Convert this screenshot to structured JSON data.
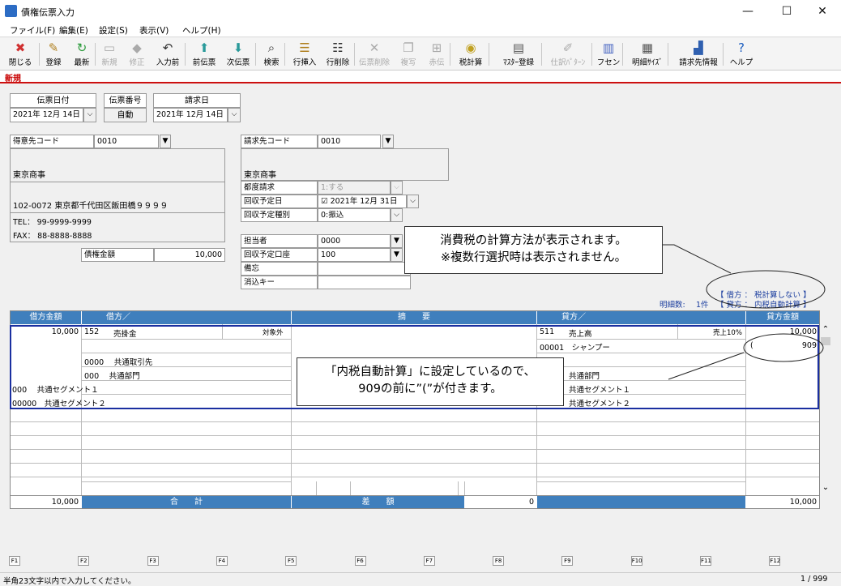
{
  "window": {
    "title": "債権伝票入力",
    "minimize": "—",
    "maximize": "☐",
    "close": "✕"
  },
  "menu": [
    "ファイル(F)",
    "編集(E)",
    "設定(S)",
    "表示(V)",
    "ヘルプ(H)"
  ],
  "toolbar": [
    {
      "label": "閉じる",
      "icon": "close-doc-icon",
      "glyph": "✖",
      "color": "#d03030",
      "enabled": true
    },
    {
      "label": "登録",
      "icon": "register-icon",
      "glyph": "✎",
      "color": "#b08020",
      "enabled": true
    },
    {
      "label": "最新",
      "icon": "refresh-icon",
      "glyph": "↻",
      "color": "#2a9a3a",
      "enabled": true
    },
    {
      "label": "新規",
      "icon": "new-doc-icon",
      "glyph": "▭",
      "color": "#aaaaaa",
      "enabled": false
    },
    {
      "label": "修正",
      "icon": "edit-icon",
      "glyph": "◆",
      "color": "#aaaaaa",
      "enabled": false
    },
    {
      "label": "入力前",
      "icon": "undo-input-icon",
      "glyph": "↶",
      "color": "#333333",
      "enabled": true
    },
    {
      "label": "前伝票",
      "icon": "prev-slip-icon",
      "glyph": "⬆",
      "color": "#2a9a9a",
      "enabled": true
    },
    {
      "label": "次伝票",
      "icon": "next-slip-icon",
      "glyph": "⬇",
      "color": "#2a9a9a",
      "enabled": true
    },
    {
      "label": "検索",
      "icon": "search-icon",
      "glyph": "⌕",
      "color": "#333333",
      "enabled": true
    },
    {
      "label": "行挿入",
      "icon": "insert-row-icon",
      "glyph": "☰",
      "color": "#b08020",
      "enabled": true
    },
    {
      "label": "行削除",
      "icon": "delete-row-icon",
      "glyph": "☷",
      "color": "#333333",
      "enabled": true
    },
    {
      "label": "伝票削除",
      "icon": "delete-slip-icon",
      "glyph": "✕",
      "color": "#aaaaaa",
      "enabled": false
    },
    {
      "label": "複写",
      "icon": "copy-icon",
      "glyph": "❐",
      "color": "#aaaaaa",
      "enabled": false
    },
    {
      "label": "赤伝",
      "icon": "red-slip-icon",
      "glyph": "⊞",
      "color": "#aaaaaa",
      "enabled": false
    },
    {
      "label": "税計算",
      "icon": "tax-calc-icon",
      "glyph": "◉",
      "color": "#c0a020",
      "enabled": true
    },
    {
      "label": "ﾏｽﾀｰ登録",
      "icon": "master-register-icon",
      "glyph": "▤",
      "color": "#555555",
      "enabled": true
    },
    {
      "label": "仕訳ﾊﾟﾀｰﾝ",
      "icon": "journal-pattern-icon",
      "glyph": "✐",
      "color": "#aaaaaa",
      "enabled": false
    },
    {
      "label": "フセン",
      "icon": "sticky-note-icon",
      "glyph": "▥",
      "color": "#4060c0",
      "enabled": true
    },
    {
      "label": "明細ｻｲｽﾞ",
      "icon": "detail-size-icon",
      "glyph": "▦",
      "color": "#555555",
      "enabled": true
    },
    {
      "label": "請求先情報",
      "icon": "billing-info-icon",
      "glyph": "▟",
      "color": "#3060b0",
      "enabled": true
    },
    {
      "label": "ヘルプ",
      "icon": "help-icon",
      "glyph": "?",
      "color": "#2060c0",
      "enabled": true
    }
  ],
  "mode": "新規",
  "header": {
    "slip_date_label": "伝票日付",
    "slip_date": "2021年 12月 14日",
    "slip_no_label": "伝票番号",
    "slip_no": "自動",
    "bill_date_label": "請求日",
    "bill_date": "2021年 12月 14日"
  },
  "customer": {
    "code_label": "得意先コード",
    "code": "0010",
    "name": "東京商事",
    "address": "102-0072 東京都千代田区飯田橋９９９９",
    "tel": "TEL：  99-9999-9999",
    "fax": "FAX：  88-8888-8888"
  },
  "amount": {
    "label": "債権金額",
    "value": "10,000"
  },
  "billing": {
    "code_label": "請求先コード",
    "code": "0010",
    "name": "東京商事",
    "each_label": "都度請求",
    "each": "1:する",
    "due_label": "回収予定日",
    "due": "2021年 12月 31日",
    "due_type_label": "回収予定種別",
    "due_type": "0:振込",
    "staff_label": "担当者",
    "staff": "0000",
    "account_label": "回収予定口座",
    "account": "100",
    "memo_label": "備忘",
    "memo": "",
    "clear_key_label": "消込キー",
    "clear_key": ""
  },
  "tax_info": {
    "debit": "【 借方 ： 税計算しない 】",
    "credit": "【 貸方 ： 内税自動計算 】",
    "count_label": "明細数:",
    "count": "1件"
  },
  "grid": {
    "col_debit_amount": "借方金額",
    "col_debit": "借方／",
    "col_summary": "摘　　要",
    "col_credit": "貸方／",
    "col_credit_amount": "貸方金額",
    "debit_amount": "10,000",
    "debit_code": "152",
    "debit_account": "売掛金",
    "debit_tax": "対象外",
    "debit_partner": "0000　 共通取引先",
    "debit_dept": "000　 共通部門",
    "debit_seg1": "000　 共通セグメント１",
    "debit_seg2": "00000　共通セグメント２",
    "credit_code": "511",
    "credit_account": "売上高",
    "credit_tax": "売上10%",
    "credit_amount": "10,000",
    "credit_sub": "00001　シャンプー",
    "credit_tax_paren": "(",
    "credit_tax_amount": "909",
    "credit_dept": "共通部門",
    "credit_seg1": "共通セグメント１",
    "credit_seg2": "共通セグメント２",
    "total_label": "合　　計",
    "total_debit": "10,000",
    "diff_label": "差　　額",
    "diff": "0",
    "total_credit": "10,000"
  },
  "callouts": {
    "c1_line1": "消費税の計算方法が表示されます。",
    "c1_line2": "※複数行選択時は表示されません。",
    "c2_line1": "「内税自動計算」に設定しているので、",
    "c2_line2": "909の前に”(”が付きます。"
  },
  "fkeys": [
    "F1",
    "F2",
    "F3",
    "F4",
    "F5",
    "F6",
    "F7",
    "F8",
    "F9",
    "F10",
    "F11",
    "F12"
  ],
  "status": {
    "hint": "半角23文字以内で入力してください。",
    "page": "1 / 999"
  }
}
